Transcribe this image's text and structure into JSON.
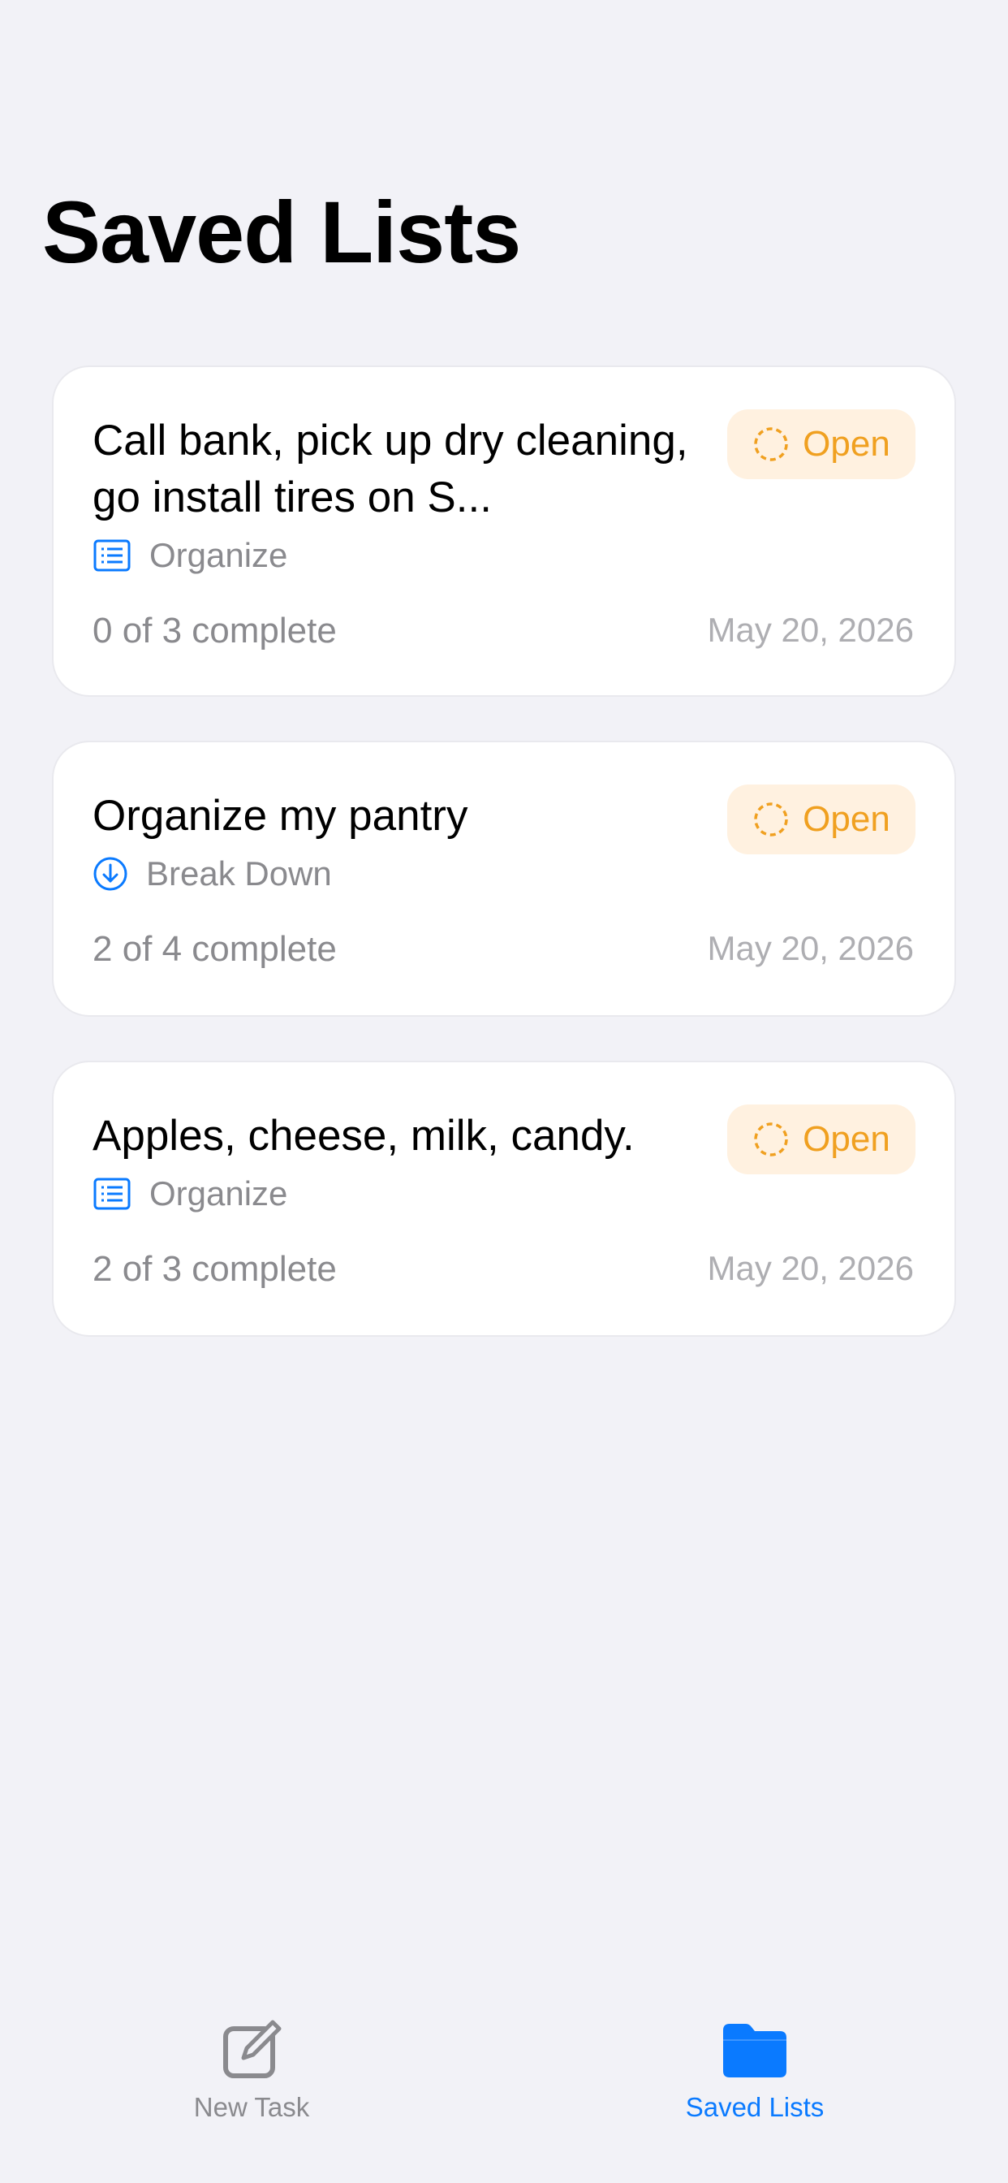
{
  "header": {
    "title": "Saved Lists"
  },
  "lists": [
    {
      "title": "Call bank, pick up dry cleaning, go install tires on S...",
      "status": "Open",
      "category": "Organize",
      "category_icon": "list-icon",
      "progress": "0 of 3 complete",
      "date": "May 20, 2026"
    },
    {
      "title": "Organize my pantry",
      "status": "Open",
      "category": "Break Down",
      "category_icon": "arrow-down-circle-icon",
      "progress": "2 of 4 complete",
      "date": "May 20, 2026"
    },
    {
      "title": "Apples, cheese, milk, candy.",
      "status": "Open",
      "category": "Organize",
      "category_icon": "list-icon",
      "progress": "2 of 3 complete",
      "date": "May 20, 2026"
    }
  ],
  "tabbar": {
    "items": [
      {
        "label": "New Task",
        "icon": "compose-icon",
        "active": false
      },
      {
        "label": "Saved Lists",
        "icon": "folder-icon",
        "active": true
      }
    ]
  },
  "colors": {
    "background": "#F2F2F7",
    "accent": "#0A7AFF",
    "status_open": "#F0A020",
    "status_open_bg": "#FFF1E0",
    "secondary_text": "#8A8A8E"
  }
}
